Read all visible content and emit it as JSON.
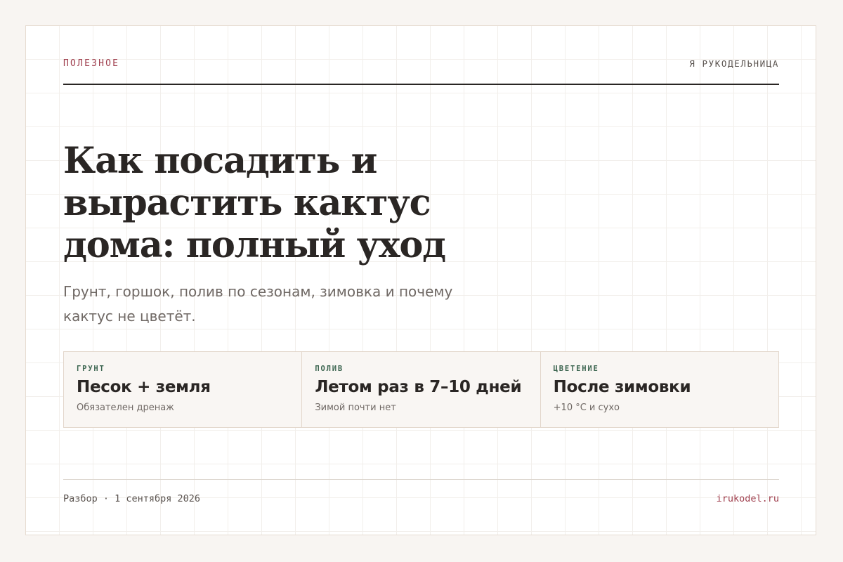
{
  "header": {
    "category": "ПОЛЕЗНОЕ",
    "brand": "Я РУКОДЕЛЬНИЦА"
  },
  "article": {
    "title": "Как посадить и вырастить кактус дома: полный уход",
    "subtitle": "Грунт, горшок, полив по сезонам, зимовка и почему кактус не цветёт."
  },
  "facts": [
    {
      "label": "ГРУНТ",
      "value": "Песок + земля",
      "note": "Обязателен дренаж"
    },
    {
      "label": "ПОЛИВ",
      "value": "Летом раз в 7–10 дней",
      "note": "Зимой почти нет"
    },
    {
      "label": "ЦВЕТЕНИЕ",
      "value": "После зимовки",
      "note": "+10 °C и сухо"
    }
  ],
  "footer": {
    "meta": "Разбор · 1 сентября 2026",
    "site": "irukodel.ru"
  },
  "colors": {
    "accent": "#a0404f",
    "label_green": "#3d6651",
    "text": "#2a2624",
    "muted": "#6f6864"
  }
}
